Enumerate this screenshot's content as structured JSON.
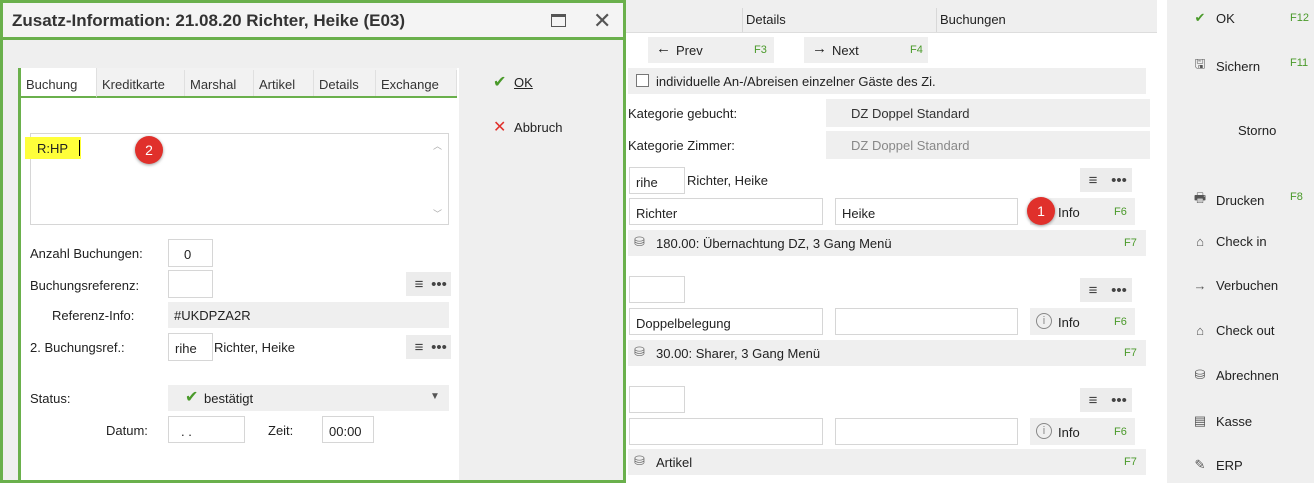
{
  "dialog": {
    "title": "Zusatz-Information: 21.08.20 Richter, Heike (E03)"
  },
  "tabs": [
    "Buchung",
    "Kreditkarte",
    "Marshal",
    "Artikel",
    "Details",
    "Exchange"
  ],
  "memo": {
    "value": "R:HP"
  },
  "badges": {
    "one": "1",
    "two": "2"
  },
  "fields": {
    "anzahl_label": "Anzahl Buchungen:",
    "anzahl_value": "0",
    "ref_label": "Buchungsreferenz:",
    "ref_value": "",
    "refinfo_label": "Referenz-Info:",
    "refinfo_value": "#UKDPZA2R",
    "ref2_label": "2. Buchungsref.:",
    "ref2_code": "rihe",
    "ref2_name": "Richter, Heike",
    "status_label": "Status:",
    "status_value": "bestätigt",
    "datum_label": "Datum:",
    "datum_value": ". .",
    "zeit_label": "Zeit:",
    "zeit_value": "00:00"
  },
  "dialog_actions": {
    "ok": "OK",
    "abbruch": "Abbruch"
  },
  "top_tabs": {
    "details": "Details",
    "buchungen": "Buchungen"
  },
  "nav": {
    "prev": "Prev",
    "prev_key": "F3",
    "next": "Next",
    "next_key": "F4"
  },
  "main": {
    "checkbox_label": "individuelle An-/Abreisen einzelner Gäste des Zi.",
    "kat_gebucht_label": "Kategorie gebucht:",
    "kat_gebucht_value": "DZ Doppel Standard",
    "kat_zimmer_label": "Kategorie Zimmer:",
    "kat_zimmer_value": "DZ Doppel Standard",
    "guest1": {
      "code": "rihe",
      "name": "Richter, Heike",
      "last": "Richter",
      "first": "Heike",
      "info": "Info",
      "info_key": "F6",
      "rate": "180.00: Übernachtung DZ, 3 Gang Menü",
      "rate_key": "F7"
    },
    "guest2": {
      "code": "",
      "name": "",
      "last": "Doppelbelegung",
      "first": "",
      "info": "Info",
      "info_key": "F6",
      "rate": "30.00: Sharer, 3 Gang Menü",
      "rate_key": "F7"
    },
    "guest3": {
      "code": "",
      "last": "",
      "first": "",
      "info": "Info",
      "info_key": "F6",
      "rate": "Artikel",
      "rate_key": "F7"
    }
  },
  "sidebar": [
    {
      "label": "OK",
      "key": "F12",
      "icon": "check-icon"
    },
    {
      "label": "Sichern",
      "key": "F11",
      "icon": "save-icon"
    },
    {
      "label": "Storno",
      "key": "",
      "icon": ""
    },
    {
      "label": "Drucken",
      "key": "F8",
      "icon": "printer-icon"
    },
    {
      "label": "Check in",
      "key": "",
      "icon": "house-icon"
    },
    {
      "label": "Verbuchen",
      "key": "",
      "icon": "arrow-right-icon"
    },
    {
      "label": "Check out",
      "key": "",
      "icon": "house-icon"
    },
    {
      "label": "Abrechnen",
      "key": "",
      "icon": "coins-icon"
    },
    {
      "label": "Kasse",
      "key": "",
      "icon": "register-icon"
    },
    {
      "label": "ERP",
      "key": "",
      "icon": "edit-icon"
    }
  ]
}
